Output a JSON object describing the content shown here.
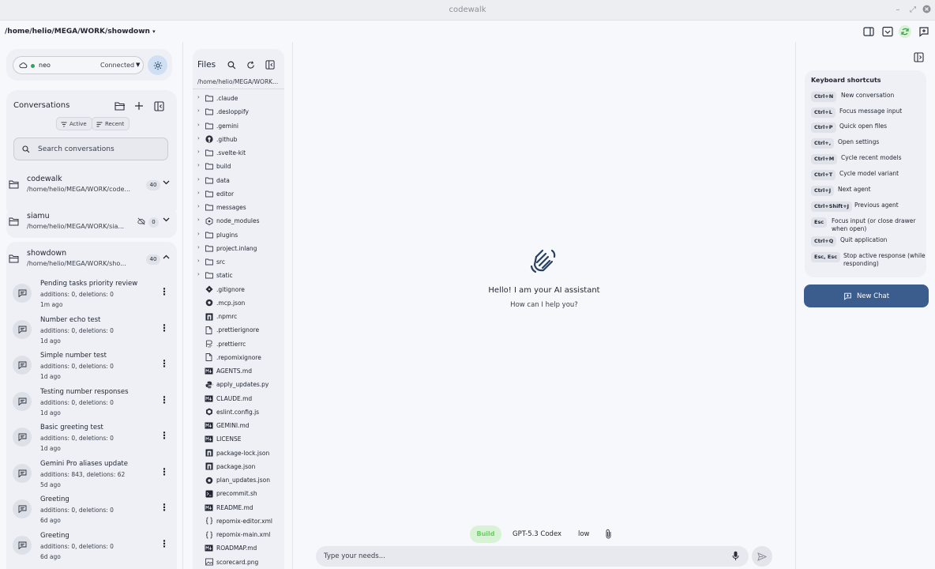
{
  "window": {
    "title": "codewalk"
  },
  "pathbar": {
    "path": "/home/helio/MEGA/WORK/showdown"
  },
  "connection": {
    "name": "neo",
    "status": "Connected"
  },
  "conversations": {
    "title": "Conversations",
    "filters": [
      "Active",
      "Recent"
    ],
    "search_placeholder": "Search conversations"
  },
  "groups": [
    {
      "name": "codewalk",
      "path": "/home/helio/MEGA/WORK/code...",
      "count": "40"
    },
    {
      "name": "siamu",
      "path": "/home/helio/MEGA/WORK/sia...",
      "count": "0"
    },
    {
      "name": "showdown",
      "path": "/home/helio/MEGA/WORK/sho...",
      "count": "40"
    }
  ],
  "items": [
    {
      "title": "Pending tasks priority review",
      "stats": "additions: 0, deletions: 0",
      "date": "1m ago"
    },
    {
      "title": "Number echo test",
      "stats": "additions: 0, deletions: 0",
      "date": "1d ago"
    },
    {
      "title": "Simple number test",
      "stats": "additions: 0, deletions: 0",
      "date": "1d ago"
    },
    {
      "title": "Testing number responses",
      "stats": "additions: 0, deletions: 0",
      "date": "1d ago"
    },
    {
      "title": "Basic greeting test",
      "stats": "additions: 0, deletions: 0",
      "date": "1d ago"
    },
    {
      "title": "Gemini Pro aliases update",
      "stats": "additions: 843, deletions: 62",
      "date": "5d ago"
    },
    {
      "title": "Greeting",
      "stats": "additions: 0, deletions: 0",
      "date": "6d ago"
    },
    {
      "title": "Greeting",
      "stats": "additions: 0, deletions: 0",
      "date": "6d ago"
    }
  ],
  "files": {
    "title": "Files",
    "path": "/home/helio/MEGA/WORK...",
    "tree": [
      {
        "name": ".claude",
        "type": "folder"
      },
      {
        "name": ".desloppify",
        "type": "folder"
      },
      {
        "name": ".gemini",
        "type": "folder"
      },
      {
        "name": ".github",
        "type": "github"
      },
      {
        "name": ".svelte-kit",
        "type": "folder"
      },
      {
        "name": "build",
        "type": "folder"
      },
      {
        "name": "data",
        "type": "folder"
      },
      {
        "name": "editor",
        "type": "folder"
      },
      {
        "name": "messages",
        "type": "folder"
      },
      {
        "name": "node_modules",
        "type": "node"
      },
      {
        "name": "plugins",
        "type": "folder"
      },
      {
        "name": "project.inlang",
        "type": "folder"
      },
      {
        "name": "src",
        "type": "folder"
      },
      {
        "name": "static",
        "type": "folder"
      },
      {
        "name": ".gitignore",
        "type": "git"
      },
      {
        "name": ".mcp.json",
        "type": "circle"
      },
      {
        "name": ".npmrc",
        "type": "npm"
      },
      {
        "name": ".prettierignore",
        "type": "file"
      },
      {
        "name": ".prettierrc",
        "type": "prettier"
      },
      {
        "name": ".repomixignore",
        "type": "file"
      },
      {
        "name": "AGENTS.md",
        "type": "md"
      },
      {
        "name": "apply_updates.py",
        "type": "python"
      },
      {
        "name": "CLAUDE.md",
        "type": "md"
      },
      {
        "name": "eslint.config.js",
        "type": "eslint"
      },
      {
        "name": "GEMINI.md",
        "type": "md"
      },
      {
        "name": "LICENSE",
        "type": "md"
      },
      {
        "name": "package-lock.json",
        "type": "npm"
      },
      {
        "name": "package.json",
        "type": "npm"
      },
      {
        "name": "plan_updates.json",
        "type": "circle"
      },
      {
        "name": "precommit.sh",
        "type": "terminal"
      },
      {
        "name": "README.md",
        "type": "md"
      },
      {
        "name": "repomix-editor.xml",
        "type": "xml"
      },
      {
        "name": "repomix-main.xml",
        "type": "xml"
      },
      {
        "name": "ROADMAP.md",
        "type": "md"
      },
      {
        "name": "scorecard.png",
        "type": "image"
      }
    ]
  },
  "main": {
    "greeting": "Hello! I am your AI assistant",
    "subgreeting": "How can I help you?",
    "mode": "Build",
    "model": "GPT-5.3 Codex",
    "effort": "low",
    "input_placeholder": "Type your needs..."
  },
  "shortcuts": {
    "title": "Keyboard shortcuts",
    "items": [
      {
        "key": "Ctrl+N",
        "desc": "New conversation"
      },
      {
        "key": "Ctrl+L",
        "desc": "Focus message input"
      },
      {
        "key": "Ctrl+P",
        "desc": "Quick open files"
      },
      {
        "key": "Ctrl+,",
        "desc": "Open settings"
      },
      {
        "key": "Ctrl+M",
        "desc": "Cycle recent models"
      },
      {
        "key": "Ctrl+T",
        "desc": "Cycle model variant"
      },
      {
        "key": "Ctrl+J",
        "desc": "Next agent"
      },
      {
        "key": "Ctrl+Shift+J",
        "desc": "Previous agent"
      },
      {
        "key": "Esc",
        "desc": "Focus input (or close drawer when open)"
      },
      {
        "key": "Ctrl+Q",
        "desc": "Quit application"
      },
      {
        "key": "Esc, Esc",
        "desc": "Stop active response (while responding)"
      }
    ]
  },
  "new_chat": {
    "label": "New Chat"
  },
  "colors": {
    "accent": "#3a5d8e",
    "build_bg": "#d8f2d6",
    "build_text": "#6ccc62",
    "connected": "#2aa65a"
  }
}
